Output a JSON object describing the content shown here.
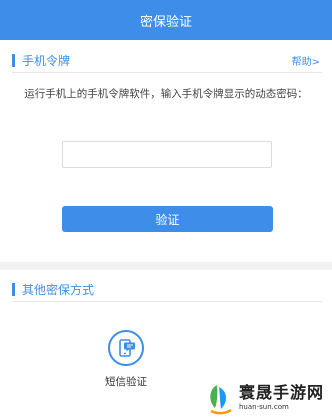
{
  "header": {
    "title": "密保验证"
  },
  "token_section": {
    "title": "手机令牌",
    "help_label": "帮助>",
    "instruction": "运行手机上的手机令牌软件，输入手机令牌显示的动态密码：",
    "input_value": "",
    "input_placeholder": "",
    "verify_label": "验证"
  },
  "other_section": {
    "title": "其他密保方式",
    "options": [
      {
        "label": "短信验证",
        "icon": "sms-phone-icon"
      }
    ]
  },
  "watermark": {
    "main": "寰晟手游网",
    "sub": "huan-sun.com"
  },
  "colors": {
    "accent": "#3e8ee9",
    "band": "#f2f2f2"
  }
}
